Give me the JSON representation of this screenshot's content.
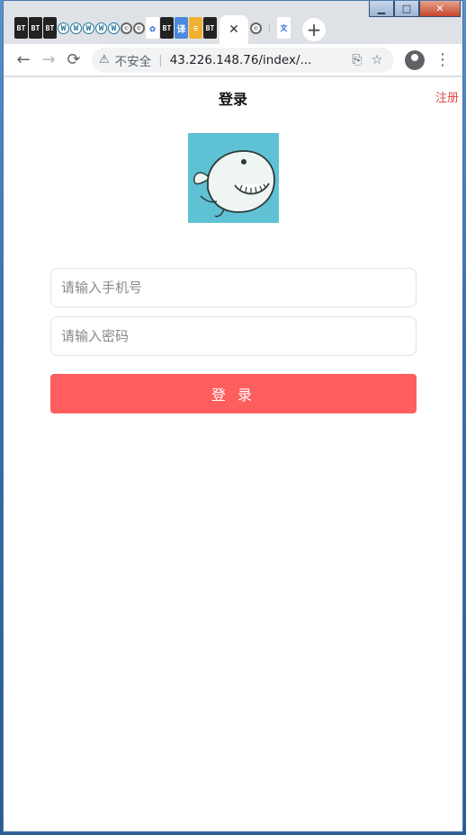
{
  "browser": {
    "tabs": [
      "BT",
      "BT",
      "BT",
      "W",
      "W",
      "W",
      "W",
      "W",
      "©",
      "©",
      "✿",
      "BT",
      "译",
      "≡",
      "BT"
    ],
    "active_tab_close": "✕",
    "extra_tabs": [
      "©",
      "⋮",
      "文"
    ],
    "new_tab": "+",
    "window_controls": {
      "minimize": "▁",
      "maximize": "□",
      "close": "✕"
    }
  },
  "toolbar": {
    "back": "←",
    "forward": "→",
    "reload": "⟳",
    "security_warning": "⚠",
    "insecure_label": "不安全",
    "separator": "|",
    "url": "43.226.148.76/index/...",
    "translate_icon": "⎘",
    "bookmark_icon": "☆",
    "menu_icon": "⋮"
  },
  "page": {
    "title": "登录",
    "register_link": "注册",
    "phone_placeholder": "请输入手机号",
    "password_placeholder": "请输入密码",
    "login_button": "登 录"
  },
  "colors": {
    "accent": "#ff5e5f",
    "register": "#e04848",
    "logo_bg": "#5fc2d4"
  }
}
